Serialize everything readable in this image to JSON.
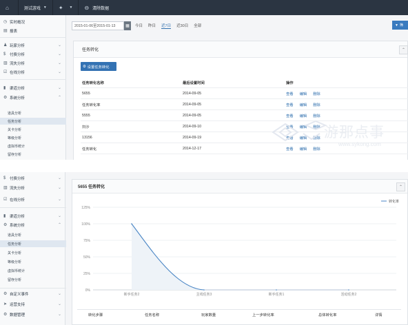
{
  "nav": {
    "game": "测试游戏",
    "clear": "清除数据"
  },
  "sidebar_top": {
    "overview": "实时概况",
    "report": "报表",
    "player": "玩家分析",
    "pay": "付费分析",
    "level": "流失分析",
    "online": "在线分析",
    "channel": "渠道分析",
    "system": "系统分析",
    "sub": [
      "道具分析",
      "任务分析",
      "关卡分析",
      "等级分析",
      "虚拟币统计",
      "留存分析"
    ]
  },
  "datebar": {
    "range": "2015-01-06至2015-01-13",
    "quick": [
      "今日",
      "昨日",
      "近7日",
      "近30日",
      "全部"
    ],
    "active_index": 2,
    "filter": "筛"
  },
  "panel1": {
    "title": "任务转化",
    "set_button": "设置任务转化",
    "headers": [
      "任务转化名称",
      "最后设置时间",
      "操作"
    ],
    "rows": [
      {
        "name": "5655",
        "time": "2014-09-05"
      },
      {
        "name": "任务转化率",
        "time": "2014-09-05"
      },
      {
        "name": "5555",
        "time": "2014-09-05"
      },
      {
        "name": "扫沙",
        "time": "2014-09-10"
      },
      {
        "name": "13156",
        "time": "2014-09-19"
      },
      {
        "name": "任务转化",
        "time": "2014-12-17"
      }
    ],
    "actions": [
      "查看",
      "编辑",
      "删除"
    ]
  },
  "watermark": {
    "text": "游那点事",
    "url": "www.sykong.com"
  },
  "sidebar_bottom": {
    "pay": "付费分析",
    "level": "流失分析",
    "online": "在线分析",
    "channel": "渠道分析",
    "system": "系统分析",
    "sub": [
      "道具分析",
      "任务分析",
      "关卡分析",
      "等级分析",
      "虚拟币统计",
      "留存分析"
    ],
    "custom": "自定义事件",
    "ops": "运营支持",
    "mgmt": "数据管理"
  },
  "panel2": {
    "title": "5655 任务转化",
    "legend": "转化率",
    "footer_headers": [
      "转化步骤",
      "任务名称",
      "玩家数量",
      "上一步转化率",
      "总体转化率",
      "详情"
    ]
  },
  "chart_data": {
    "type": "area",
    "x": [
      "新手任务2",
      "主线任务3",
      "新手任务1",
      "活动任务2"
    ],
    "series": [
      {
        "name": "转化率",
        "values": [
          100,
          0,
          0,
          0
        ]
      }
    ],
    "yticks": [
      "125%",
      "100%",
      "75%",
      "50%",
      "25%",
      "0%"
    ],
    "ylim": [
      0,
      125
    ],
    "grid": true,
    "legend_position": "top-right",
    "colors": {
      "line": "#4a86c5",
      "fill": "#eef3f8"
    }
  }
}
